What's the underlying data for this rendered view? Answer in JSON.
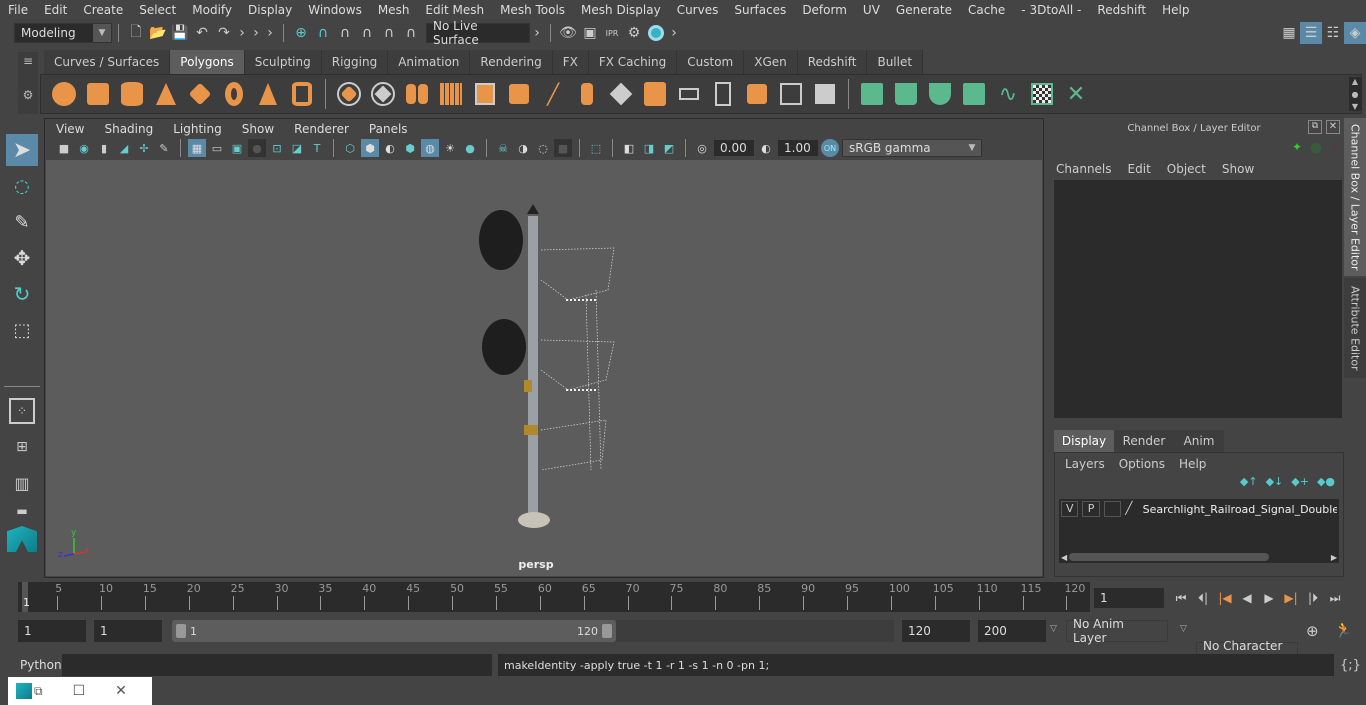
{
  "menubar": {
    "items": [
      "File",
      "Edit",
      "Create",
      "Select",
      "Modify",
      "Display",
      "Windows",
      "Mesh",
      "Edit Mesh",
      "Mesh Tools",
      "Mesh Display",
      "Curves",
      "Surfaces",
      "Deform",
      "UV",
      "Generate",
      "Cache",
      "- 3DtoAll -",
      "Redshift",
      "Help"
    ]
  },
  "toolbar": {
    "workspace": "Modeling",
    "live_surface": "No Live Surface"
  },
  "shelf": {
    "tabs": [
      "Curves / Surfaces",
      "Polygons",
      "Sculpting",
      "Rigging",
      "Animation",
      "Rendering",
      "FX",
      "FX Caching",
      "Custom",
      "XGen",
      "Redshift",
      "Bullet"
    ],
    "active_tab": "Polygons",
    "poly_icons": [
      "sphere-icon",
      "cube-icon",
      "cylinder-icon",
      "cone-icon",
      "plane-icon",
      "torus-icon",
      "pyramid-icon",
      "pipe-icon"
    ],
    "edit_icons": [
      "combine-icon",
      "separate-icon",
      "mirror-icon",
      "smooth-icon",
      "extrude-icon",
      "bevel-icon",
      "bridge-icon",
      "multicut-icon",
      "target-weld-icon",
      "quad-draw-icon",
      "fill-hole-icon",
      "merge-icon",
      "append-icon",
      "insert-edge-loop-icon",
      "poke-icon"
    ],
    "uv_icons": [
      "planar-uv-icon",
      "cylindrical-uv-icon",
      "spherical-uv-icon",
      "auto-uv-icon",
      "unfold-uv-icon",
      "uv-editor-icon",
      "cut-sew-uv-icon"
    ]
  },
  "viewport": {
    "menus": [
      "View",
      "Shading",
      "Lighting",
      "Show",
      "Renderer",
      "Panels"
    ],
    "exposure": "0.00",
    "gamma": "1.00",
    "color_space": "sRGB gamma",
    "camera_label": "persp",
    "axis": {
      "x": "x",
      "y": "y",
      "z": "z"
    }
  },
  "channel_box": {
    "title": "Channel Box / Layer Editor",
    "menus": [
      "Channels",
      "Edit",
      "Object",
      "Show"
    ]
  },
  "layer_editor": {
    "tabs": [
      "Display",
      "Render",
      "Anim"
    ],
    "active_tab": "Display",
    "menus": [
      "Layers",
      "Options",
      "Help"
    ],
    "layers": [
      {
        "v": "V",
        "p": "P",
        "name": "Searchlight_Railroad_Signal_Double_"
      }
    ]
  },
  "side_tabs": [
    "Channel Box / Layer Editor",
    "Attribute Editor"
  ],
  "timeline": {
    "ticks": [
      5,
      10,
      15,
      20,
      25,
      30,
      35,
      40,
      45,
      50,
      55,
      60,
      65,
      70,
      75,
      80,
      85,
      90,
      95,
      100,
      105,
      110,
      115,
      120
    ],
    "current_frame_marker": "1",
    "current_frame": "1"
  },
  "range": {
    "start": "1",
    "playback_start": "1",
    "slider_start": "1",
    "slider_end": "120",
    "playback_end": "120",
    "end": "200",
    "anim_layer": "No Anim Layer",
    "character_set": "No Character Set"
  },
  "command_line": {
    "language": "Python",
    "input": "",
    "result": "makeIdentity -apply true -t 1 -r 1 -s 1 -n 0 -pn 1;"
  }
}
